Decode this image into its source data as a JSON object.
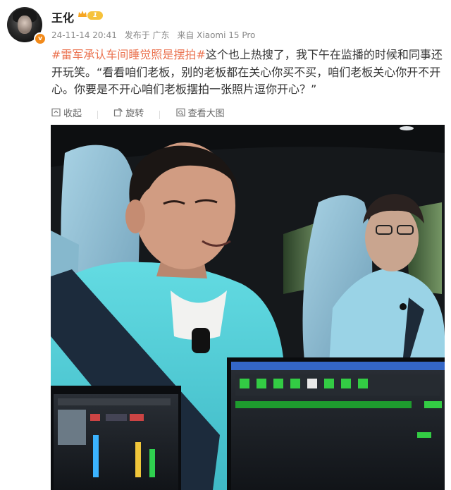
{
  "user": {
    "name": "王化",
    "level": "1",
    "vip_icon": "crown-icon",
    "verified_icon": "v-badge-icon"
  },
  "meta": {
    "timestamp": "24-11-14 20:41",
    "location": "发布于 广东",
    "source": "来自 Xiaomi 15 Pro"
  },
  "post": {
    "hashtag": "#雷军承认车间睡觉照是摆拍#",
    "text": "这个也上热搜了，我下午在监播的时候和同事还开玩笑。“看看咱们老板，别的老板都在关心你买不买，咱们老板关心你开不开心。你要是不开心咱们老板摆拍一张照片逗你开心？”"
  },
  "actions": {
    "collapse": "收起",
    "repost": "旋转",
    "view_large": "查看大图"
  },
  "colors": {
    "hashtag": "#eb7350",
    "jacket": "#5ad0d8",
    "seat": "#8fc2d8"
  }
}
